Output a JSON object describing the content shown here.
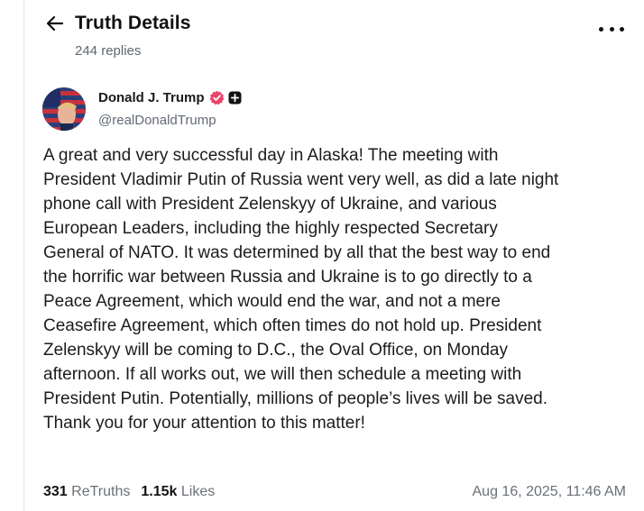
{
  "header": {
    "title": "Truth Details",
    "replies": "244 replies",
    "back_icon": "arrow-left-icon",
    "more_icon": "ellipsis-icon"
  },
  "post": {
    "author": {
      "display_name": "Donald J. Trump",
      "handle": "@realDonaldTrump",
      "verified_icon": "verified-badge-icon",
      "verified_color": "#e8456b",
      "extra_icon": "plus-square-icon"
    },
    "lines": [
      "A great and very successful day in Alaska! The meeting with",
      "President Vladimir Putin of Russia went very well, as did a late night",
      "phone call with President Zelenskyy of Ukraine, and various",
      "European Leaders, including the highly respected Secretary",
      "General of NATO. It was determined by all that the best way to end",
      "the horrific war between Russia and Ukraine is to go directly to a",
      "Peace Agreement, which would end the war, and not a mere",
      "Ceasefire Agreement, which often times do not hold up. President",
      "Zelenskyy will be coming to D.C., the Oval Office, on Monday",
      "afternoon. If all works out, we will then schedule a meeting with",
      "President Putin. Potentially, millions of people’s lives will be saved.",
      "Thank you for your attention to this matter!"
    ],
    "stats": {
      "retruths_count": "331",
      "retruths_label": "ReTruths",
      "likes_count": "1.15k",
      "likes_label": "Likes"
    },
    "timestamp": "Aug 16, 2025, 11:46 AM"
  }
}
